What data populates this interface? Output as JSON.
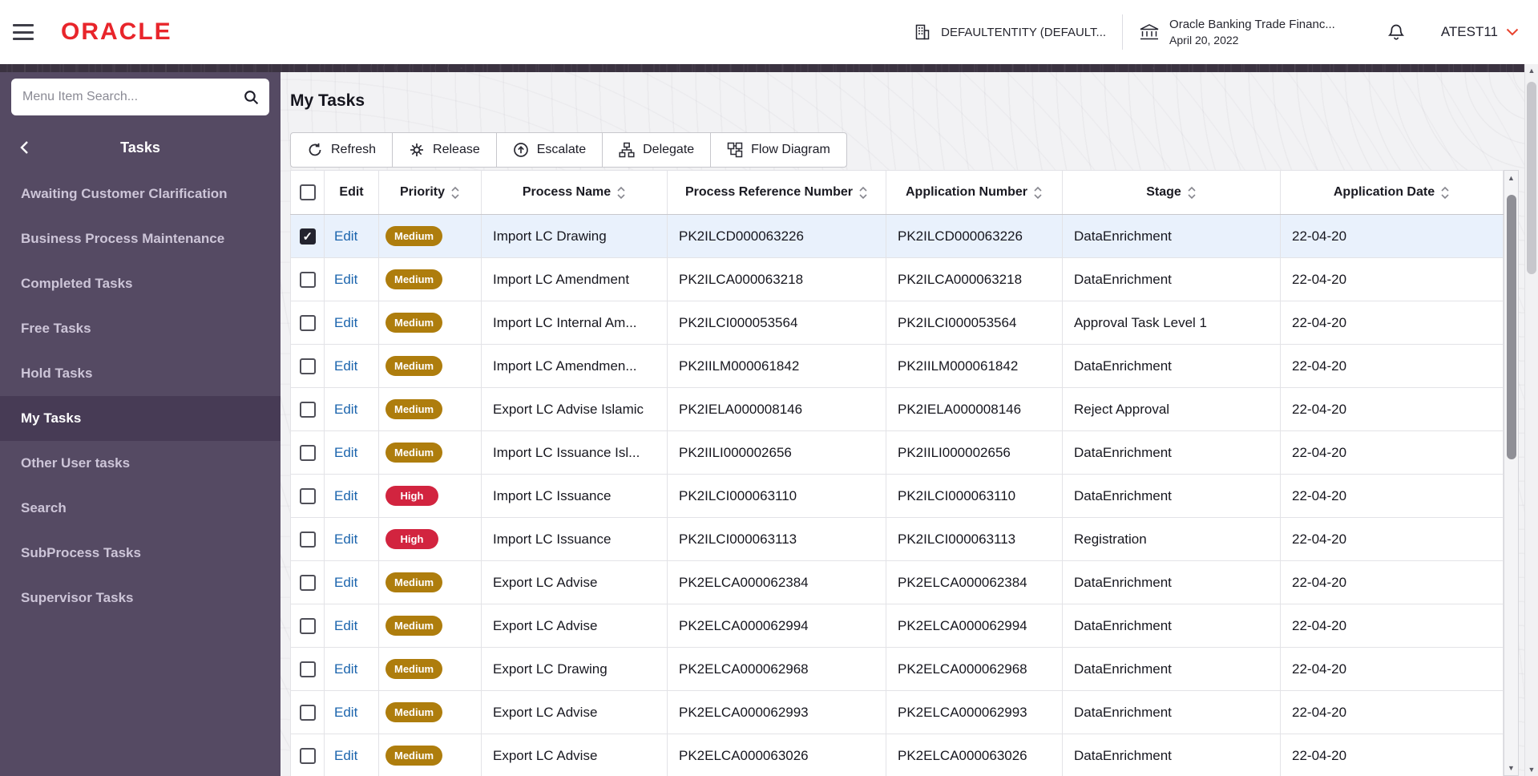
{
  "header": {
    "logo": "ORACLE",
    "entity_label": "DEFAULTENTITY (DEFAULT...",
    "app_title": "Oracle Banking Trade Financ...",
    "app_date": "April 20, 2022",
    "user_label": "ATEST11"
  },
  "sidebar": {
    "search_placeholder": "Menu Item Search...",
    "section_title": "Tasks",
    "items": [
      {
        "label": "Awaiting Customer Clarification",
        "active": false
      },
      {
        "label": "Business Process Maintenance",
        "active": false
      },
      {
        "label": "Completed Tasks",
        "active": false
      },
      {
        "label": "Free Tasks",
        "active": false
      },
      {
        "label": "Hold Tasks",
        "active": false
      },
      {
        "label": "My Tasks",
        "active": true
      },
      {
        "label": "Other User tasks",
        "active": false
      },
      {
        "label": "Search",
        "active": false
      },
      {
        "label": "SubProcess Tasks",
        "active": false
      },
      {
        "label": "Supervisor Tasks",
        "active": false
      }
    ]
  },
  "main": {
    "title": "My Tasks",
    "toolbar": [
      {
        "label": "Refresh",
        "icon": "refresh-icon"
      },
      {
        "label": "Release",
        "icon": "release-icon"
      },
      {
        "label": "Escalate",
        "icon": "escalate-icon"
      },
      {
        "label": "Delegate",
        "icon": "delegate-icon"
      },
      {
        "label": "Flow Diagram",
        "icon": "flow-diagram-icon"
      }
    ],
    "table": {
      "edit_label": "Edit",
      "columns": [
        {
          "label": "Edit",
          "sortable": false
        },
        {
          "label": "Priority",
          "sortable": true
        },
        {
          "label": "Process Name",
          "sortable": true
        },
        {
          "label": "Process Reference Number",
          "sortable": true
        },
        {
          "label": "Application Number",
          "sortable": true
        },
        {
          "label": "Stage",
          "sortable": true
        },
        {
          "label": "Application Date",
          "sortable": true
        }
      ],
      "rows": [
        {
          "selected": true,
          "checked": true,
          "priority": "Medium",
          "process_name": "Import LC Drawing",
          "process_ref": "PK2ILCD000063226",
          "app_no": "PK2ILCD000063226",
          "stage": "DataEnrichment",
          "date": "22-04-20"
        },
        {
          "selected": false,
          "checked": false,
          "priority": "Medium",
          "process_name": "Import LC Amendment",
          "process_ref": "PK2ILCA000063218",
          "app_no": "PK2ILCA000063218",
          "stage": "DataEnrichment",
          "date": "22-04-20"
        },
        {
          "selected": false,
          "checked": false,
          "priority": "Medium",
          "process_name": "Import LC Internal Am...",
          "process_ref": "PK2ILCI000053564",
          "app_no": "PK2ILCI000053564",
          "stage": "Approval Task Level 1",
          "date": "22-04-20"
        },
        {
          "selected": false,
          "checked": false,
          "priority": "Medium",
          "process_name": "Import LC Amendmen...",
          "process_ref": "PK2IILM000061842",
          "app_no": "PK2IILM000061842",
          "stage": "DataEnrichment",
          "date": "22-04-20"
        },
        {
          "selected": false,
          "checked": false,
          "priority": "Medium",
          "process_name": "Export LC Advise Islamic",
          "process_ref": "PK2IELA000008146",
          "app_no": "PK2IELA000008146",
          "stage": "Reject Approval",
          "date": "22-04-20"
        },
        {
          "selected": false,
          "checked": false,
          "priority": "Medium",
          "process_name": "Import LC Issuance Isl...",
          "process_ref": "PK2IILI000002656",
          "app_no": "PK2IILI000002656",
          "stage": "DataEnrichment",
          "date": "22-04-20"
        },
        {
          "selected": false,
          "checked": false,
          "priority": "High",
          "process_name": "Import LC Issuance",
          "process_ref": "PK2ILCI000063110",
          "app_no": "PK2ILCI000063110",
          "stage": "DataEnrichment",
          "date": "22-04-20"
        },
        {
          "selected": false,
          "checked": false,
          "priority": "High",
          "process_name": "Import LC Issuance",
          "process_ref": "PK2ILCI000063113",
          "app_no": "PK2ILCI000063113",
          "stage": "Registration",
          "date": "22-04-20"
        },
        {
          "selected": false,
          "checked": false,
          "priority": "Medium",
          "process_name": "Export LC Advise",
          "process_ref": "PK2ELCA000062384",
          "app_no": "PK2ELCA000062384",
          "stage": "DataEnrichment",
          "date": "22-04-20"
        },
        {
          "selected": false,
          "checked": false,
          "priority": "Medium",
          "process_name": "Export LC Advise",
          "process_ref": "PK2ELCA000062994",
          "app_no": "PK2ELCA000062994",
          "stage": "DataEnrichment",
          "date": "22-04-20"
        },
        {
          "selected": false,
          "checked": false,
          "priority": "Medium",
          "process_name": "Export LC Drawing",
          "process_ref": "PK2ELCA000062968",
          "app_no": "PK2ELCA000062968",
          "stage": "DataEnrichment",
          "date": "22-04-20"
        },
        {
          "selected": false,
          "checked": false,
          "priority": "Medium",
          "process_name": "Export LC Advise",
          "process_ref": "PK2ELCA000062993",
          "app_no": "PK2ELCA000062993",
          "stage": "DataEnrichment",
          "date": "22-04-20"
        },
        {
          "selected": false,
          "checked": false,
          "priority": "Medium",
          "process_name": "Export LC Advise",
          "process_ref": "PK2ELCA000063026",
          "app_no": "PK2ELCA000063026",
          "stage": "DataEnrichment",
          "date": "22-04-20"
        }
      ]
    }
  },
  "colors": {
    "priority_medium": "#ae7d0d",
    "priority_high": "#d2243f",
    "logo_red": "#e8252b",
    "sidebar_bg": "#554a63",
    "sidebar_active_bg": "#473b55",
    "selected_row_bg": "#e9f1fc",
    "edit_link": "#1b64ad"
  }
}
